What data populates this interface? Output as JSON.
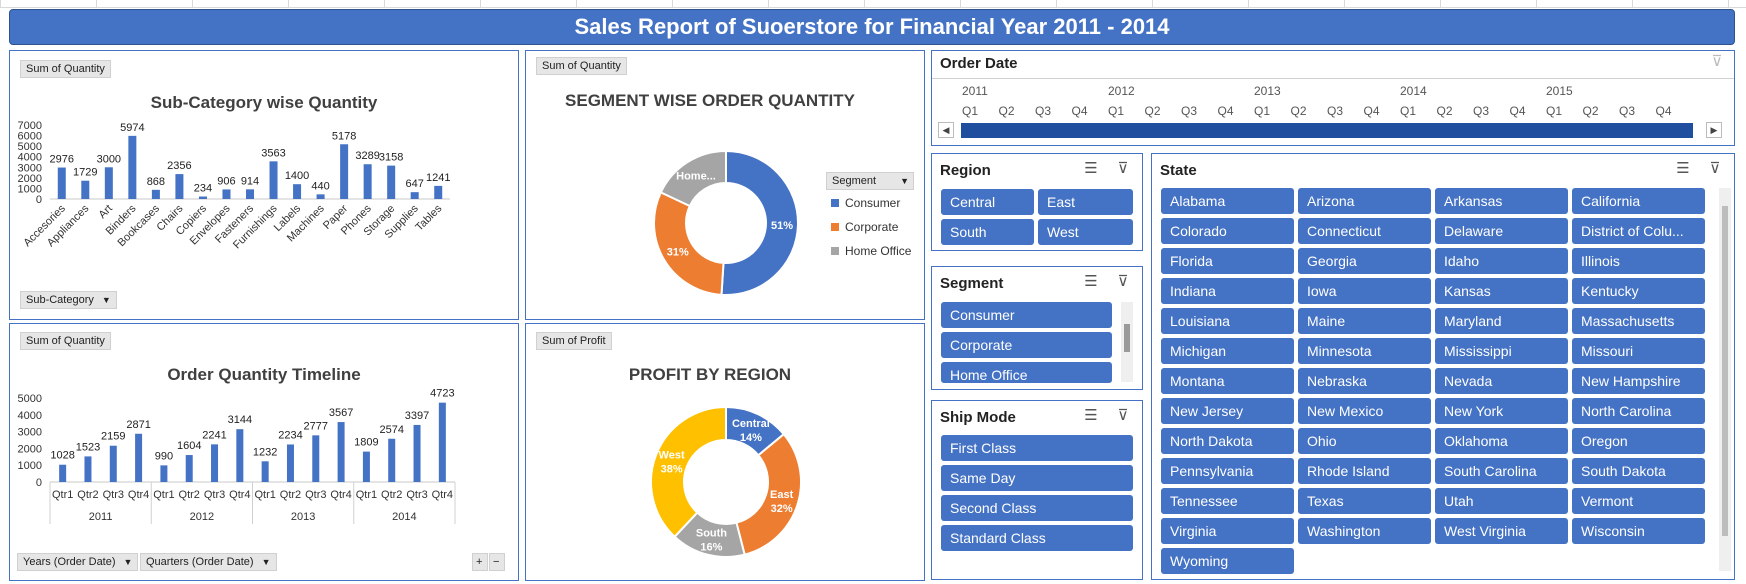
{
  "title": "Sales Report of Suoerstore for Financial Year 2011 - 2014",
  "colors": {
    "accent": "#4472c4",
    "orange": "#ed7d31",
    "gray": "#a5a5a5",
    "gold": "#ffc000"
  },
  "subcat_panel": {
    "field_button": "Sum of Quantity",
    "title": "Sub-Category wise Quantity",
    "axis_button": "Sub-Category"
  },
  "segment_panel": {
    "field_button": "Sum of Quantity",
    "title": "SEGMENT WISE ORDER QUANTITY",
    "legend_button": "Segment",
    "legend": [
      "Consumer",
      "Corporate",
      "Home Office"
    ],
    "labels": [
      "51%",
      "31%",
      "Home..."
    ]
  },
  "timeline_panel": {
    "field_button": "Sum of Quantity",
    "title": "Order Quantity Timeline",
    "axis_buttons": [
      "Years (Order Date)",
      "Quarters (Order Date)"
    ],
    "plus": "+",
    "minus": "−"
  },
  "profit_panel": {
    "field_button": "Sum of Profit",
    "title": "PROFIT BY REGION",
    "labels": [
      {
        "name": "Central",
        "pct": "14%"
      },
      {
        "name": "East",
        "pct": "32%"
      },
      {
        "name": "South",
        "pct": "16%"
      },
      {
        "name": "West",
        "pct": "38%"
      }
    ]
  },
  "chart_data": [
    {
      "type": "bar",
      "title": "Sub-Category wise Quantity",
      "categories": [
        "Accesories",
        "Appliances",
        "Art",
        "Binders",
        "Bookcases",
        "Chairs",
        "Copiers",
        "Envelopes",
        "Fasteners",
        "Furnishings",
        "Labels",
        "Machines",
        "Paper",
        "Phones",
        "Storage",
        "Supplies",
        "Tables"
      ],
      "values": [
        2976,
        1729,
        3000,
        5974,
        868,
        2356,
        234,
        906,
        914,
        3563,
        1400,
        440,
        5178,
        3289,
        3158,
        647,
        1241
      ],
      "ylim": [
        0,
        7000
      ],
      "yticks": [
        0,
        1000,
        2000,
        3000,
        4000,
        5000,
        6000,
        7000
      ],
      "color": "#4472c4"
    },
    {
      "type": "pie",
      "title": "SEGMENT WISE ORDER QUANTITY",
      "categories": [
        "Consumer",
        "Corporate",
        "Home Office"
      ],
      "values": [
        51,
        31,
        18
      ],
      "colors": [
        "#4472c4",
        "#ed7d31",
        "#a5a5a5"
      ],
      "donut": true
    },
    {
      "type": "bar",
      "title": "Order Quantity Timeline",
      "groups": [
        "2011",
        "2012",
        "2013",
        "2014"
      ],
      "categories": [
        "Qtr1",
        "Qtr2",
        "Qtr3",
        "Qtr4"
      ],
      "values": [
        [
          1028,
          1523,
          2159,
          2871
        ],
        [
          990,
          1604,
          2241,
          3144
        ],
        [
          1232,
          2234,
          2777,
          3567
        ],
        [
          1809,
          2574,
          3397,
          4723
        ]
      ],
      "ylim": [
        0,
        5000
      ],
      "yticks": [
        0,
        1000,
        2000,
        3000,
        4000,
        5000
      ],
      "color": "#4472c4"
    },
    {
      "type": "pie",
      "title": "PROFIT BY REGION",
      "categories": [
        "Central",
        "East",
        "South",
        "West"
      ],
      "values": [
        14,
        32,
        16,
        38
      ],
      "colors": [
        "#4472c4",
        "#ed7d31",
        "#a5a5a5",
        "#ffc000"
      ],
      "donut": true
    }
  ],
  "order_date": {
    "title": "Order Date",
    "years": [
      "2011",
      "2012",
      "2013",
      "2014",
      "2015"
    ],
    "quarters": [
      "Q1",
      "Q2",
      "Q3",
      "Q4",
      "Q1",
      "Q2",
      "Q3",
      "Q4",
      "Q1",
      "Q2",
      "Q3",
      "Q4",
      "Q1",
      "Q2",
      "Q3",
      "Q4",
      "Q1",
      "Q2",
      "Q3",
      "Q4"
    ],
    "left_arrow": "◀",
    "right_arrow": "▶"
  },
  "region": {
    "title": "Region",
    "items": [
      "Central",
      "East",
      "South",
      "West"
    ]
  },
  "segment": {
    "title": "Segment",
    "items": [
      "Consumer",
      "Corporate",
      "Home Office"
    ]
  },
  "ship_mode": {
    "title": "Ship Mode",
    "items": [
      "First Class",
      "Same Day",
      "Second Class",
      "Standard Class"
    ]
  },
  "state": {
    "title": "State",
    "items": [
      "Alabama",
      "Arizona",
      "Arkansas",
      "California",
      "Colorado",
      "Connecticut",
      "Delaware",
      "District of Colu...",
      "Florida",
      "Georgia",
      "Idaho",
      "Illinois",
      "Indiana",
      "Iowa",
      "Kansas",
      "Kentucky",
      "Louisiana",
      "Maine",
      "Maryland",
      "Massachusetts",
      "Michigan",
      "Minnesota",
      "Mississippi",
      "Missouri",
      "Montana",
      "Nebraska",
      "Nevada",
      "New Hampshire",
      "New Jersey",
      "New Mexico",
      "New York",
      "North Carolina",
      "North Dakota",
      "Ohio",
      "Oklahoma",
      "Oregon",
      "Pennsylvania",
      "Rhode Island",
      "South Carolina",
      "South Dakota",
      "Tennessee",
      "Texas",
      "Utah",
      "Vermont",
      "Virginia",
      "Washington",
      "West Virginia",
      "Wisconsin",
      "Wyoming"
    ]
  }
}
